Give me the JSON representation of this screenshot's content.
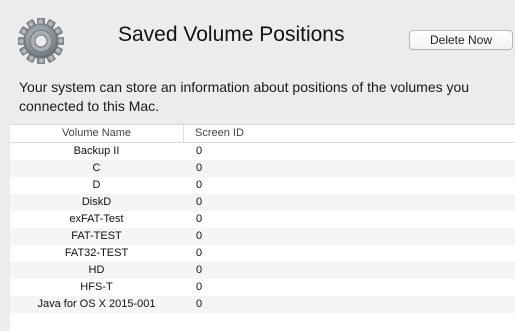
{
  "header": {
    "title": "Saved Volume Positions",
    "delete_label": "Delete Now",
    "icon": "gear-icon"
  },
  "description": "Your system can store an information about positions of the volumes you\nconnected to this Mac.",
  "table": {
    "columns": [
      "Volume Name",
      "Screen ID"
    ],
    "rows": [
      {
        "name": "Backup II",
        "screen_id": "0"
      },
      {
        "name": "C",
        "screen_id": "0"
      },
      {
        "name": "D",
        "screen_id": "0"
      },
      {
        "name": "DiskD",
        "screen_id": "0"
      },
      {
        "name": "exFAT-Test",
        "screen_id": "0"
      },
      {
        "name": "FAT-TEST",
        "screen_id": "0"
      },
      {
        "name": "FAT32-TEST",
        "screen_id": "0"
      },
      {
        "name": "HD",
        "screen_id": "0"
      },
      {
        "name": "HFS-T",
        "screen_id": "0"
      },
      {
        "name": "Java for OS X 2015-001",
        "screen_id": "0"
      }
    ]
  }
}
